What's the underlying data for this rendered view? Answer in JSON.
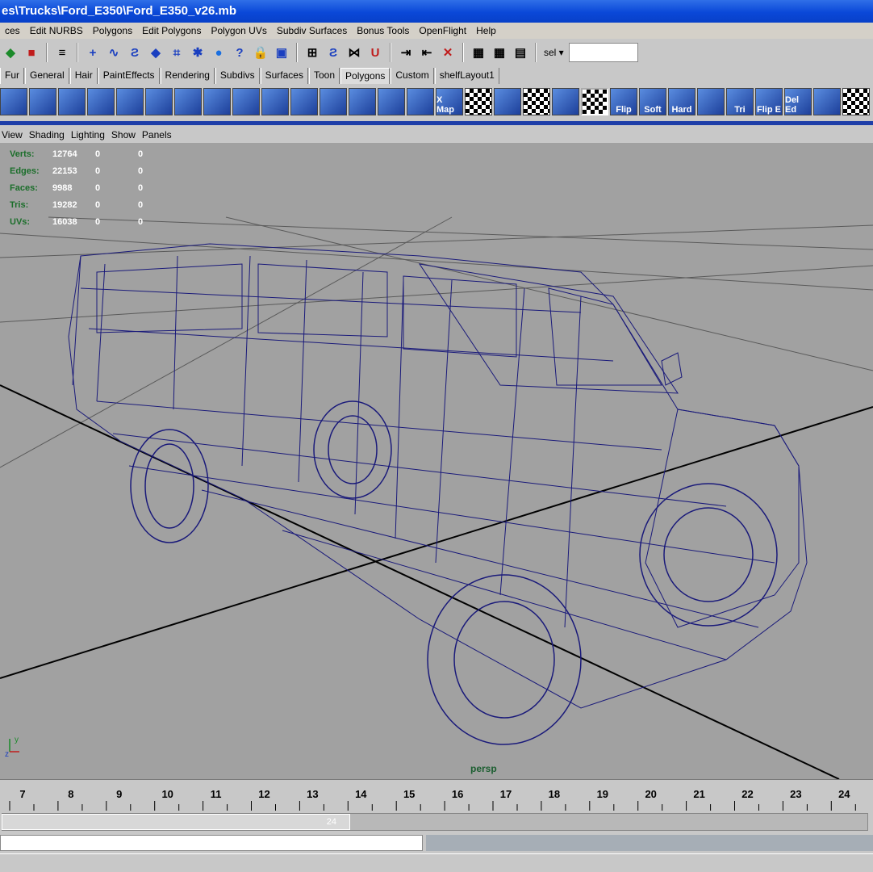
{
  "window": {
    "title": "es\\Trucks\\Ford_E350\\Ford_E350_v26.mb"
  },
  "menubar": [
    "ces",
    "Edit NURBS",
    "Polygons",
    "Edit Polygons",
    "Polygon UVs",
    "Subdiv Surfaces",
    "Bonus Tools",
    "OpenFlight",
    "Help"
  ],
  "statusline": {
    "sel_label": "sel",
    "sel_value": ""
  },
  "shelf_tabs": [
    "Fur",
    "General",
    "Hair",
    "PaintEffects",
    "Rendering",
    "Subdivs",
    "Surfaces",
    "Toon",
    "Polygons",
    "Custom",
    "shelfLayout1"
  ],
  "active_shelf_tab": "Polygons",
  "shelf_tools": [
    "",
    "",
    "",
    "",
    "",
    "",
    "",
    "",
    "",
    "",
    "",
    "",
    "",
    "",
    "",
    "X Map",
    "",
    "",
    "",
    "",
    "",
    "Flip",
    "Soft",
    "Hard",
    "",
    "Tri",
    "Flip E",
    "Del Ed",
    "",
    ""
  ],
  "panel_menu": [
    "View",
    "Shading",
    "Lighting",
    "Show",
    "Panels"
  ],
  "hud": [
    {
      "label": "Verts:",
      "value": "12764",
      "sel": "0",
      "comp": "0"
    },
    {
      "label": "Edges:",
      "value": "22153",
      "sel": "0",
      "comp": "0"
    },
    {
      "label": "Faces:",
      "value": "9988",
      "sel": "0",
      "comp": "0"
    },
    {
      "label": "Tris:",
      "value": "19282",
      "sel": "0",
      "comp": "0"
    },
    {
      "label": "UVs:",
      "value": "16038",
      "sel": "0",
      "comp": "0"
    }
  ],
  "viewport": {
    "camera_label": "persp",
    "axis_y": "y",
    "axis_z": "z"
  },
  "timeslider": {
    "frames": [
      "7",
      "8",
      "9",
      "10",
      "11",
      "12",
      "13",
      "14",
      "15",
      "16",
      "17",
      "18",
      "19",
      "20",
      "21",
      "22",
      "23",
      "24"
    ]
  },
  "range": {
    "end_value": "24"
  },
  "colors": {
    "wireframe": "#1a1a7a",
    "viewport_bg": "#a1a1a1",
    "title_blue": "#0a48d8",
    "hud_label": "#1b6e2a"
  }
}
